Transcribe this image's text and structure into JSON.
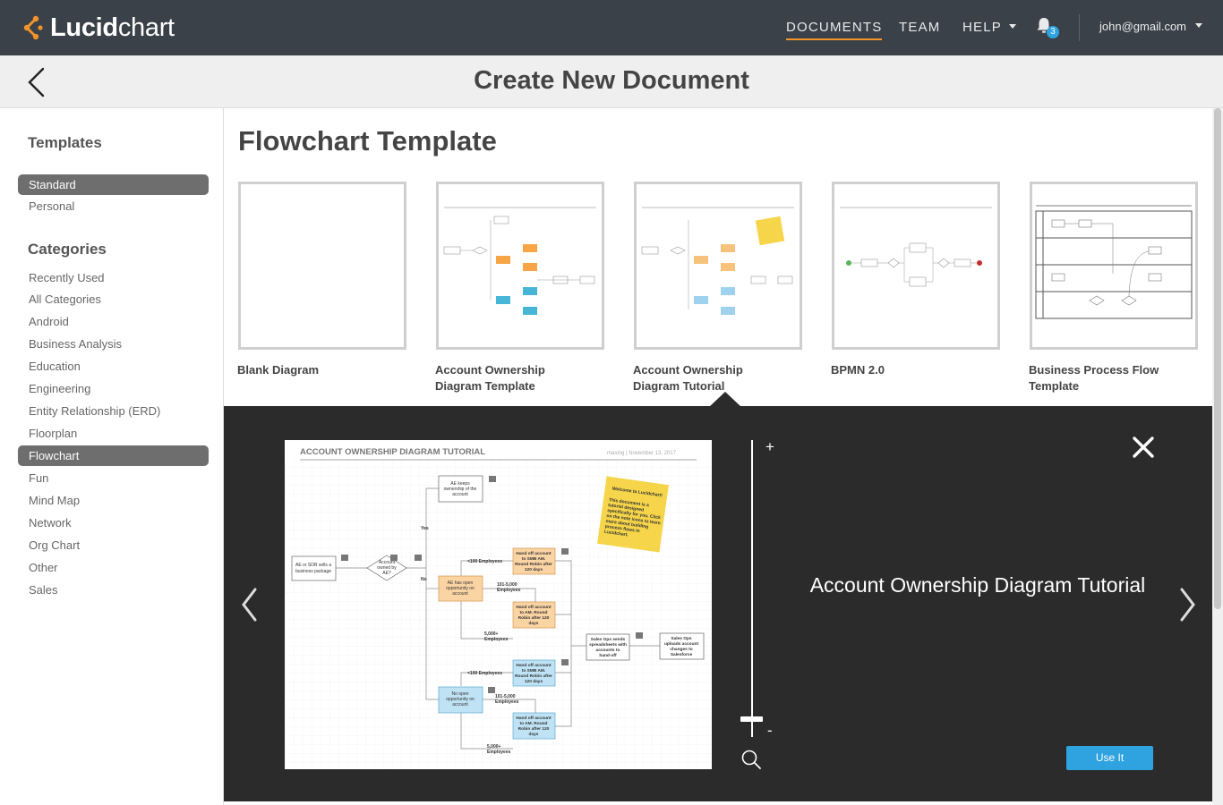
{
  "app": {
    "logo_bold": "Lucid",
    "logo_light": "chart"
  },
  "nav": {
    "documents": "DOCUMENTS",
    "team": "TEAM",
    "help": "HELP",
    "notifications_count": "3",
    "user_email": "john@gmail.com"
  },
  "header": {
    "title": "Create New Document"
  },
  "sidebar": {
    "templates_heading": "Templates",
    "template_sources": [
      {
        "label": "Standard",
        "selected": true
      },
      {
        "label": "Personal",
        "selected": false
      }
    ],
    "categories_heading": "Categories",
    "categories": [
      {
        "label": "Recently Used"
      },
      {
        "label": "All Categories"
      },
      {
        "label": "Android"
      },
      {
        "label": "Business Analysis"
      },
      {
        "label": "Education"
      },
      {
        "label": "Engineering"
      },
      {
        "label": "Entity Relationship (ERD)"
      },
      {
        "label": "Floorplan"
      },
      {
        "label": "Flowchart",
        "selected": true
      },
      {
        "label": "Fun"
      },
      {
        "label": "Mind Map"
      },
      {
        "label": "Network"
      },
      {
        "label": "Org Chart"
      },
      {
        "label": "Other"
      },
      {
        "label": "Sales"
      }
    ]
  },
  "main": {
    "title": "Flowchart Template",
    "templates": [
      {
        "label": "Blank Diagram"
      },
      {
        "label_line1": "Account Ownership",
        "label_line2": "Diagram Template"
      },
      {
        "label_line1": "Account Ownership",
        "label_line2": "Diagram Tutorial"
      },
      {
        "label": "BPMN 2.0"
      },
      {
        "label_line1": "Business Process Flow",
        "label_line2": "Template"
      }
    ]
  },
  "preview": {
    "title": "Account Ownership Diagram Tutorial",
    "use_button": "Use It",
    "zoom_plus": "+",
    "zoom_minus": "-",
    "diagram": {
      "heading": "ACCOUNT OWNERSHIP DIAGRAM TUTORIAL",
      "meta": "masing   |   November 13, 2017",
      "note_title": "Welcome to Lucidchart!",
      "note_body": "This document is a tutorial designed specifically for you. Click on the note icons to learn more about building process flows in Lucidchart.",
      "start": "AE or SDR sells a business package",
      "decision": "Account owned by AE?",
      "yes": "Yes",
      "no": "No",
      "keeps": "AE keeps ownership of the account",
      "has_opp": "AE has open opportunity on account",
      "no_opp": "No open opportunity on account",
      "lt100": "<100 Employees",
      "mid": "101-5,000 Employees",
      "gt5000": "5,000+ Employees",
      "smb": "Hand off account to SMB AM. Round Robin after 120 days",
      "am": "Hand off account to AM. Round Robin after 120 days",
      "ops": "Sales Ops sends spreadsheets with accounts to hand-off",
      "sf": "Sales Ops uploads account changes to Salesforce"
    }
  },
  "colors": {
    "nav_bg": "#3a4148",
    "accent_orange": "#f2932b",
    "accent_blue": "#2fa2e0",
    "preview_bg": "#2b2b2b"
  }
}
